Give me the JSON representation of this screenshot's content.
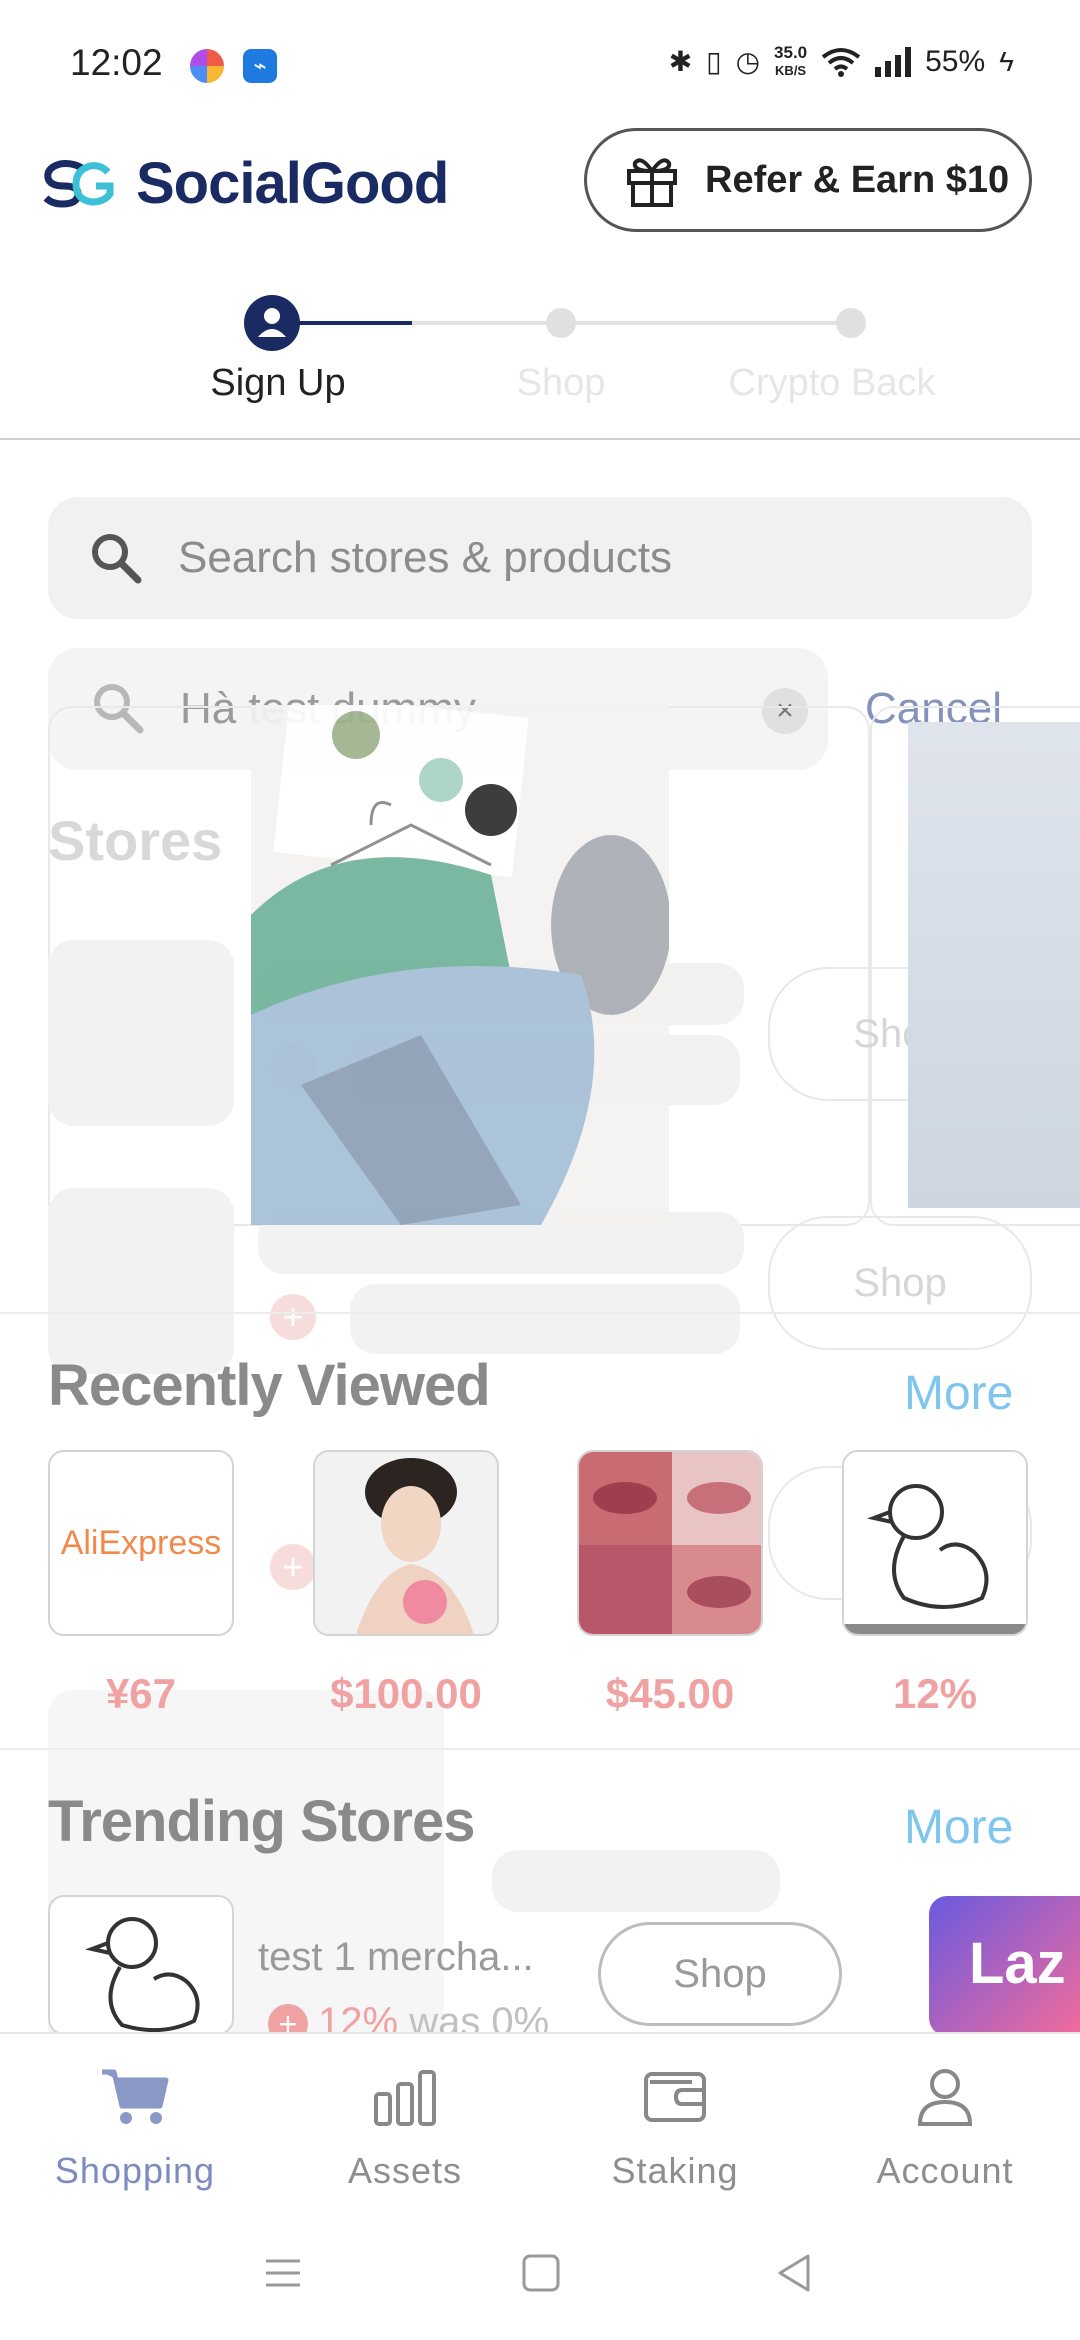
{
  "status_bar": {
    "time": "12:02",
    "net_speed_value": "35.0",
    "net_speed_unit": "KB/S",
    "battery": "55%",
    "icons": [
      "bluetooth-icon",
      "vibrate-icon",
      "alarm-icon",
      "wifi-icon",
      "signal-icon",
      "charging-icon"
    ]
  },
  "header": {
    "brand": "SocialGood",
    "refer_label": "Refer & Earn $10"
  },
  "stepper": {
    "steps": [
      "Sign Up",
      "Shop",
      "Crypto Back"
    ],
    "active_index": 0
  },
  "search": {
    "placeholder": "Search stores & products"
  },
  "overlay": {
    "search_query": "Hà test dummy",
    "cancel_label": "Cancel",
    "stores_heading": "Stores",
    "shop_label": "Shop"
  },
  "recently_viewed": {
    "title": "Recently Viewed",
    "more_label": "More",
    "items": [
      {
        "name": "AliExpress",
        "price": "¥67"
      },
      {
        "name": "",
        "price": "$100.00"
      },
      {
        "name": "",
        "price": "$45.00"
      },
      {
        "name": "",
        "price": "12%"
      }
    ]
  },
  "trending_stores": {
    "title": "Trending Stores",
    "more_label": "More",
    "store_name": "test 1 mercha...",
    "rate": "12%",
    "was_rate": "was 0%",
    "shop_label": "Shop",
    "second_store_logo": "Laz"
  },
  "bottom_nav": {
    "items": [
      "Shopping",
      "Assets",
      "Staking",
      "Account"
    ],
    "active_index": 0
  },
  "colors": {
    "brand_navy": "#1a2b63",
    "brand_cyan": "#3cc0d8",
    "price_red": "#f0a1a1",
    "more_blue": "#7fc6ee"
  }
}
